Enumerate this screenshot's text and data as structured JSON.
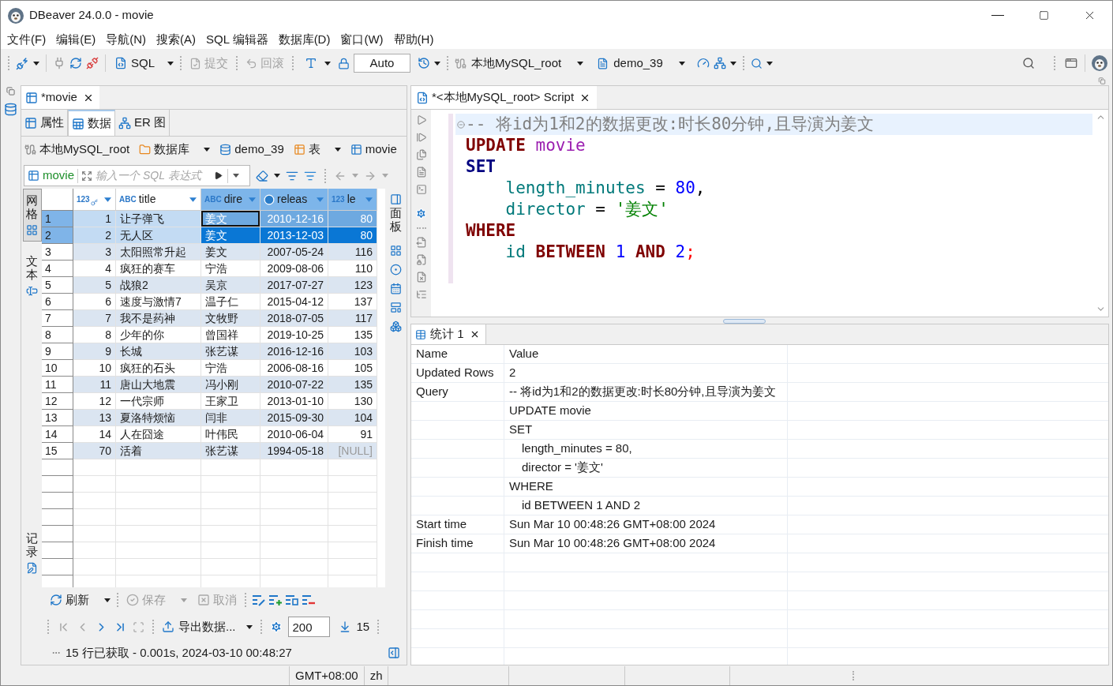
{
  "window": {
    "title": "DBeaver 24.0.0 - movie"
  },
  "menu": [
    "文件(F)",
    "编辑(E)",
    "导航(N)",
    "搜索(A)",
    "SQL 编辑器",
    "数据库(D)",
    "窗口(W)",
    "帮助(H)"
  ],
  "toolbar": {
    "sql": "SQL",
    "commit": {
      "label": "提交",
      "disabled": true
    },
    "rollback": {
      "label": "回滚",
      "disabled": true
    },
    "transaction_mode": "Auto",
    "connection": "本地MySQL_root",
    "database": "demo_39"
  },
  "left_editor": {
    "tabs": [
      {
        "label": "*movie",
        "selected": true
      }
    ],
    "sub_tabs": [
      {
        "label": "属性",
        "selected": false
      },
      {
        "label": "数据",
        "selected": true
      },
      {
        "label": "ER 图",
        "selected": false
      }
    ],
    "breadcrumb": [
      {
        "kind": "connection",
        "label": "本地MySQL_root",
        "dropdown": false
      },
      {
        "kind": "folder",
        "label": "数据库",
        "dropdown": true
      },
      {
        "kind": "database",
        "label": "demo_39",
        "dropdown": false
      },
      {
        "kind": "tables",
        "label": "表",
        "dropdown": true
      },
      {
        "kind": "table",
        "label": "movie",
        "dropdown": false
      }
    ],
    "filter": {
      "table": "movie",
      "placeholder": "输入一个 SQL 表达式"
    },
    "view_tabs": [
      {
        "kind": "view",
        "label": "网格",
        "selected": true
      },
      {
        "kind": "view",
        "label": "文本",
        "selected": false
      },
      {
        "kind": "toggle",
        "label": "记录",
        "selected": false
      }
    ],
    "side_panel": {
      "label": "面板"
    },
    "grid": {
      "columns": [
        {
          "kind": "numeric",
          "badge": "123",
          "key": true,
          "selected": false
        },
        {
          "kind": "text",
          "badge": "ABC",
          "label": "title",
          "key": false,
          "selected": false
        },
        {
          "kind": "text",
          "badge": "ABC",
          "label": "dire",
          "key": false,
          "selected": true
        },
        {
          "kind": "date",
          "label": "releas",
          "key": false,
          "selected": true
        },
        {
          "kind": "numeric",
          "badge": "123",
          "label": "le",
          "key": false,
          "selected": true
        }
      ],
      "rows": [
        {
          "number": "1",
          "selected": true,
          "focused": true,
          "cells": [
            "1",
            "让子弹飞",
            "姜文",
            "2010-12-16",
            "80"
          ]
        },
        {
          "number": "2",
          "selected": true,
          "focused": false,
          "cells": [
            "2",
            "无人区",
            "姜文",
            "2013-12-03",
            "80"
          ]
        },
        {
          "number": "3",
          "selected": false,
          "focused": false,
          "cells": [
            "3",
            "太阳照常升起",
            "姜文",
            "2007-05-24",
            "116"
          ]
        },
        {
          "number": "4",
          "selected": false,
          "focused": false,
          "cells": [
            "4",
            "疯狂的赛车",
            "宁浩",
            "2009-08-06",
            "110"
          ]
        },
        {
          "number": "5",
          "selected": false,
          "focused": false,
          "cells": [
            "5",
            "战狼2",
            "吴京",
            "2017-07-27",
            "123"
          ]
        },
        {
          "number": "6",
          "selected": false,
          "focused": false,
          "cells": [
            "6",
            "速度与激情7",
            "温子仁",
            "2015-04-12",
            "137"
          ]
        },
        {
          "number": "7",
          "selected": false,
          "focused": false,
          "cells": [
            "7",
            "我不是药神",
            "文牧野",
            "2018-07-05",
            "117"
          ]
        },
        {
          "number": "8",
          "selected": false,
          "focused": false,
          "cells": [
            "8",
            "少年的你",
            "曾国祥",
            "2019-10-25",
            "135"
          ]
        },
        {
          "number": "9",
          "selected": false,
          "focused": false,
          "cells": [
            "9",
            "长城",
            "张艺谋",
            "2016-12-16",
            "103"
          ]
        },
        {
          "number": "10",
          "selected": false,
          "focused": false,
          "cells": [
            "10",
            "疯狂的石头",
            "宁浩",
            "2006-08-16",
            "105"
          ]
        },
        {
          "number": "11",
          "selected": false,
          "focused": false,
          "cells": [
            "11",
            "唐山大地震",
            "冯小刚",
            "2010-07-22",
            "135"
          ]
        },
        {
          "number": "12",
          "selected": false,
          "focused": false,
          "cells": [
            "12",
            "一代宗师",
            "王家卫",
            "2013-01-10",
            "130"
          ]
        },
        {
          "number": "13",
          "selected": false,
          "focused": false,
          "cells": [
            "13",
            "夏洛特烦恼",
            "闫非",
            "2015-09-30",
            "104"
          ]
        },
        {
          "number": "14",
          "selected": false,
          "focused": false,
          "cells": [
            "14",
            "人在囧途",
            "叶伟民",
            "2010-06-04",
            "91"
          ]
        },
        {
          "number": "15",
          "selected": false,
          "focused": false,
          "cells": [
            "70",
            "活着",
            "张艺谋",
            "1994-05-18",
            {
              "kind": "null",
              "text": "[NULL]"
            }
          ]
        }
      ]
    },
    "edit_actions": [
      {
        "kind": "refresh",
        "label": "刷新",
        "disabled": false
      },
      {
        "kind": "save",
        "label": "保存",
        "disabled": true
      },
      {
        "kind": "cancel",
        "label": "取消",
        "disabled": true
      }
    ],
    "navigation": [
      {
        "disabled": true
      },
      {
        "disabled": true
      },
      {
        "disabled": false
      },
      {
        "disabled": false
      }
    ],
    "export_label": "导出数据...",
    "fetch_size": "200",
    "row_count": "15",
    "status": "15 行已获取 - 0.001s, 2024-03-10 00:48:27"
  },
  "script_editor": {
    "tabs": [
      {
        "label": "*<本地MySQL_root> Script",
        "selected": true
      }
    ],
    "lines": [
      {
        "current": true,
        "foldable": true,
        "indented": false,
        "tokens": [
          {
            "kind": "comment",
            "text": "-- 将id为1和2的数据更改:时长80分钟,且导演为姜文"
          }
        ]
      },
      {
        "current": false,
        "foldable": false,
        "indented": false,
        "tokens": [
          {
            "kind": "keyword",
            "text": "UPDATE "
          },
          {
            "kind": "table",
            "text": "movie"
          }
        ]
      },
      {
        "current": false,
        "foldable": false,
        "indented": false,
        "tokens": [
          {
            "kind": "keyword2",
            "text": "SET"
          }
        ]
      },
      {
        "current": false,
        "foldable": false,
        "indented": true,
        "tokens": [
          {
            "kind": "column",
            "text": "length_minutes"
          },
          {
            "kind": "plain",
            "text": " = "
          },
          {
            "kind": "number",
            "text": "80"
          },
          {
            "kind": "plain",
            "text": ","
          }
        ]
      },
      {
        "current": false,
        "foldable": false,
        "indented": true,
        "tokens": [
          {
            "kind": "column",
            "text": "director"
          },
          {
            "kind": "plain",
            "text": " = "
          },
          {
            "kind": "string",
            "text": "'姜文'"
          }
        ]
      },
      {
        "current": false,
        "foldable": false,
        "indented": false,
        "tokens": [
          {
            "kind": "keyword",
            "text": "WHERE"
          }
        ]
      },
      {
        "current": false,
        "foldable": false,
        "indented": true,
        "tokens": [
          {
            "kind": "column",
            "text": "id "
          },
          {
            "kind": "keyword",
            "text": "BETWEEN "
          },
          {
            "kind": "number",
            "text": "1 "
          },
          {
            "kind": "keyword",
            "text": "AND "
          },
          {
            "kind": "number",
            "text": "2"
          },
          {
            "kind": "terminator",
            "text": ";"
          }
        ]
      }
    ]
  },
  "results": {
    "tabs": [
      {
        "label": "统计 1",
        "selected": true
      }
    ],
    "columns": [
      "Name",
      "Value"
    ],
    "rows": [
      {
        "name": "Updated Rows",
        "value": "2",
        "indented": false
      },
      {
        "name": "Query",
        "value": "-- 将id为1和2的数据更改:时长80分钟,且导演为姜文",
        "indented": false
      },
      {
        "value": "UPDATE movie",
        "indented": false
      },
      {
        "value": "SET",
        "indented": false
      },
      {
        "value": "length_minutes = 80,",
        "indented": true
      },
      {
        "value": "director = '姜文'",
        "indented": true
      },
      {
        "value": "WHERE",
        "indented": false
      },
      {
        "value": "id BETWEEN 1 AND 2",
        "indented": true
      },
      {
        "name": "Start time",
        "value": "Sun Mar 10 00:48:26 GMT+08:00 2024",
        "indented": false
      },
      {
        "name": "Finish time",
        "value": "Sun Mar 10 00:48:26 GMT+08:00 2024",
        "indented": false
      }
    ]
  },
  "status_bar": [
    "GMT+08:00",
    "zh"
  ]
}
